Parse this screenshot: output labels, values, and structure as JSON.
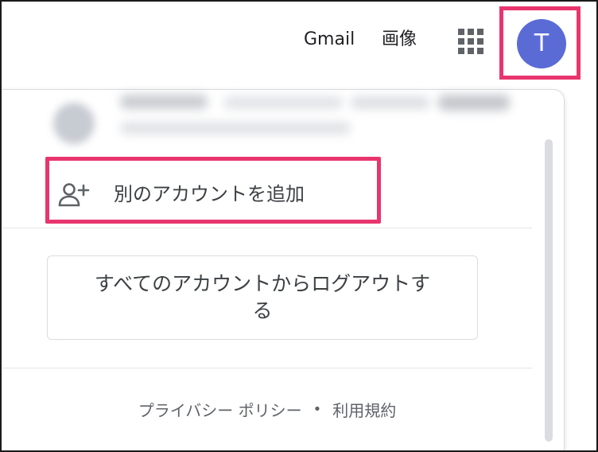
{
  "topbar": {
    "gmail_label": "Gmail",
    "images_label": "画像",
    "apps_icon": "apps-grid-icon",
    "avatar_letter": "T",
    "avatar_color": "#5b6bd6",
    "highlight_color": "#e8356e"
  },
  "account_menu": {
    "add_account_icon": "person-add-icon",
    "add_account_label": "別のアカウントを追加",
    "sign_out_label": "すべてのアカウントからログアウトする",
    "footer": {
      "privacy_label": "プライバシー ポリシー",
      "separator": "•",
      "terms_label": "利用規約"
    }
  }
}
